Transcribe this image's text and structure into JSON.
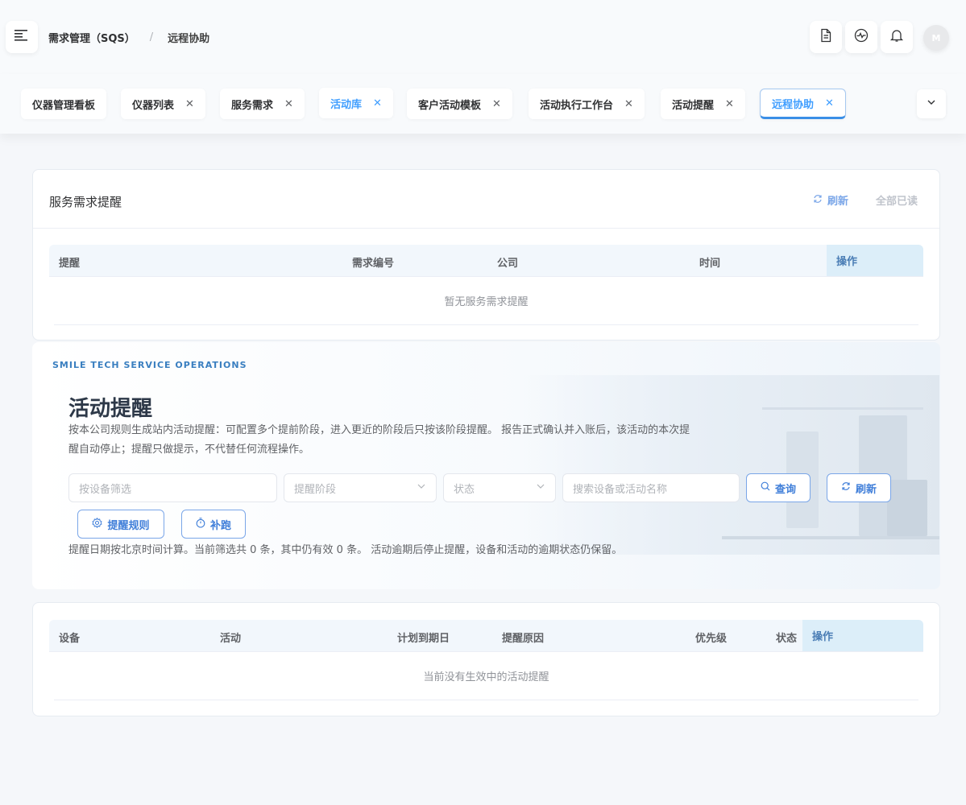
{
  "breadcrumb": {
    "root": "需求管理（SQS）",
    "sep": "/",
    "current": "远程协助"
  },
  "header": {
    "avatar_text": "M",
    "icons": [
      "document-icon",
      "activity-icon",
      "bell-icon"
    ]
  },
  "tabs": [
    {
      "label": "仪器管理看板",
      "closable": false
    },
    {
      "label": "仪器列表",
      "closable": true,
      "x": "✕"
    },
    {
      "label": "服务需求",
      "closable": true,
      "x": "✕"
    },
    {
      "label": "活动库",
      "closable": true,
      "x": "✕"
    },
    {
      "label": "客户活动模板",
      "closable": true,
      "x": "✕"
    },
    {
      "label": "活动执行工作台",
      "closable": true,
      "x": "✕"
    },
    {
      "label": "活动提醒",
      "closable": true,
      "x": "✕"
    },
    {
      "label": "远程协助",
      "closable": true,
      "x": "✕"
    }
  ],
  "service_reminder": {
    "title": "服务需求提醒",
    "refresh": "刷新",
    "read_all": "全部已读",
    "columns": [
      "提醒",
      "需求编号",
      "公司",
      "时间",
      "操作"
    ],
    "empty": "暂无服务需求提醒"
  },
  "activity_reminder": {
    "brand": "SMILE TECH SERVICE OPERATIONS",
    "title": "活动提醒",
    "desc": "按本公司规则生成站内活动提醒：可配置多个提前阶段，进入更近的阶段后只按该阶段提醒。 报告正式确认并入账后，该活动的本次提醒自动停止；提醒只做提示，不代替任何流程操作。",
    "filter_device_placeholder": "按设备筛选",
    "filter_stage_placeholder": "提醒阶段",
    "filter_status_placeholder": "状态",
    "search_placeholder": "搜索设备或活动名称",
    "query": "查询",
    "refresh": "刷新",
    "rules": "提醒规则",
    "rerun": "补跑",
    "note": "提醒日期按北京时间计算。当前筛选共 0 条，其中仍有效 0 条。 活动逾期后停止提醒，设备和活动的逾期状态仍保留。"
  },
  "activity_table": {
    "columns": [
      "设备",
      "活动",
      "计划到期日",
      "提醒原因",
      "优先级",
      "状态",
      "操作"
    ],
    "empty": "当前没有生效中的活动提醒"
  }
}
